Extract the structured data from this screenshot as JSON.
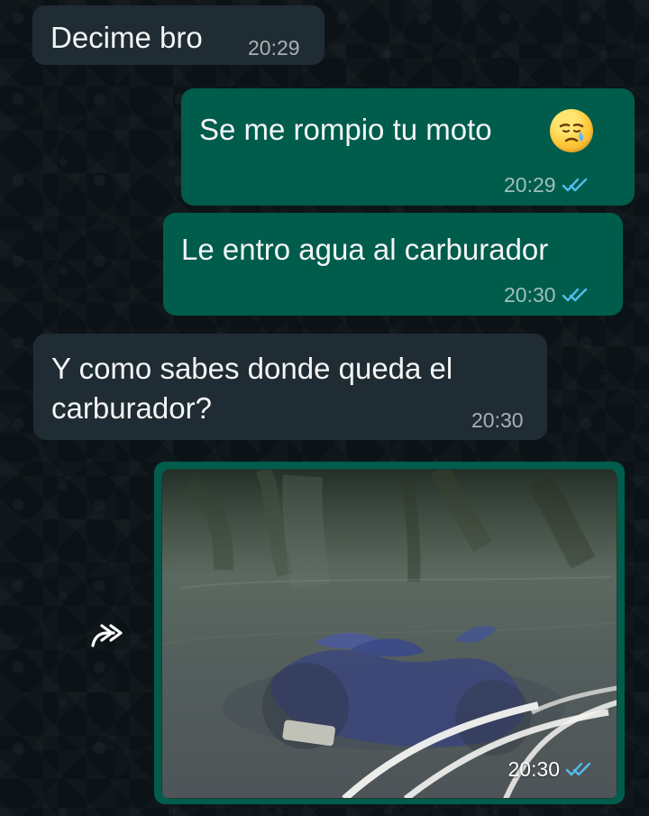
{
  "chat": {
    "messages": [
      {
        "direction": "incoming",
        "text": "Decime bro",
        "time": "20:29"
      },
      {
        "direction": "outgoing",
        "text": "Se me rompio tu moto",
        "time": "20:29",
        "emoji": "sad-face-emoji"
      },
      {
        "direction": "outgoing",
        "text": "Le entro agua al carburador",
        "time": "20:30"
      },
      {
        "direction": "incoming",
        "line1": "Y como sabes donde queda el",
        "line2": "carburador?",
        "time": "20:30"
      },
      {
        "direction": "outgoing",
        "type": "image",
        "time": "20:30"
      }
    ]
  },
  "icons": {
    "read_ticks": "double-check-icon",
    "forward": "forward-icon"
  },
  "colors": {
    "incoming_bubble": "#202c33",
    "outgoing_bubble": "#005c4b",
    "read_tick": "#53bdeb"
  }
}
